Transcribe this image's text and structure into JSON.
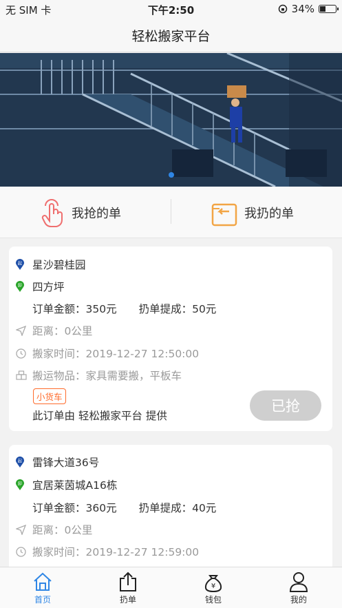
{
  "status_bar": {
    "carrier": "无 SIM 卡",
    "time": "下午2:50",
    "battery": "34%"
  },
  "navbar": {
    "title": "轻松搬家平台"
  },
  "quick_actions": [
    {
      "label": "我抢的单",
      "icon": "hand-tap-icon"
    },
    {
      "label": "我扔的单",
      "icon": "return-box-icon"
    }
  ],
  "orders": [
    {
      "pickup": "星沙碧桂园",
      "dropoff": "四方坪",
      "amount": "订单金额：350元",
      "commission": "扔单提成：50元",
      "distance": "距离：0公里",
      "move_time": "搬家时间：2019-12-27 12:50:00",
      "items": "搬运物品：家具需要搬，平板车",
      "vehicle_tag": "小货车",
      "provider": "此订单由 轻松搬家平台 提供",
      "action": "已抢"
    },
    {
      "pickup": "雷锋大道36号",
      "dropoff": "宜居莱茵城A16栋",
      "amount": "订单金额：360元",
      "commission": "扔单提成：40元",
      "distance": "距离：0公里",
      "move_time": "搬家时间：2019-12-27 12:59:00"
    }
  ],
  "tabbar": [
    {
      "label": "首页",
      "icon": "home-icon",
      "active": true
    },
    {
      "label": "扔单",
      "icon": "share-upload-icon",
      "active": false
    },
    {
      "label": "钱包",
      "icon": "money-bag-icon",
      "active": false
    },
    {
      "label": "我的",
      "icon": "user-icon",
      "active": false
    }
  ],
  "colors": {
    "accent": "#2f86e5",
    "tag": "#ff6a2a",
    "grabbed_button": "#cfcfcf",
    "pickup_pin": "#1e4fa8",
    "dropoff_pin": "#2aa52a"
  }
}
